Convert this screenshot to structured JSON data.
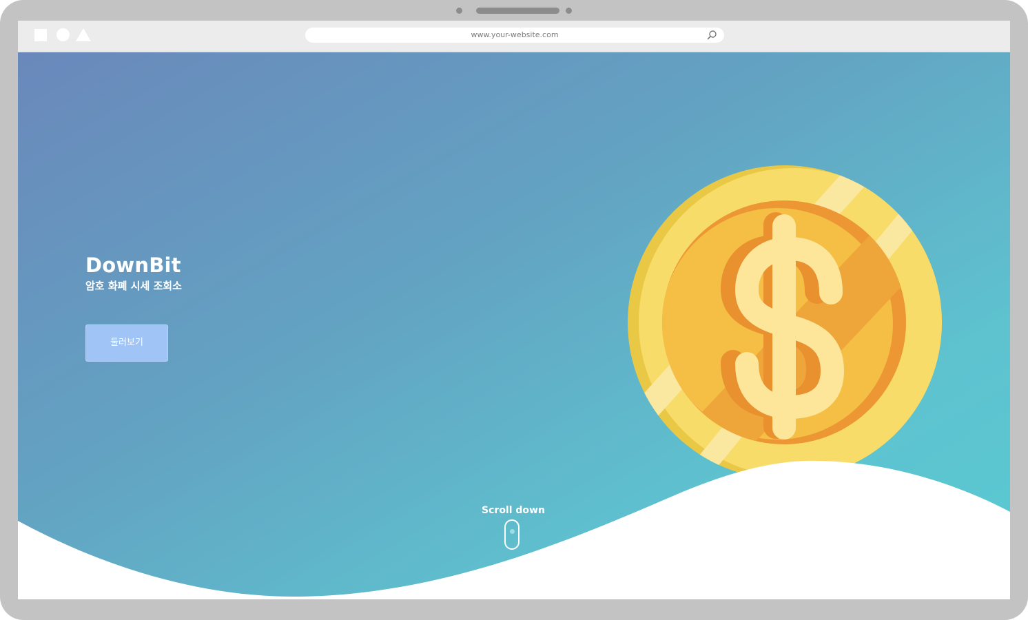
{
  "browser": {
    "url": "www.your-website.com",
    "window_controls": [
      "square-shape",
      "circle-shape",
      "triangle-shape"
    ]
  },
  "hero": {
    "title": "DownBit",
    "subtitle": "암호 화폐 시세 조회소",
    "explore_button_label": "둘러보기",
    "scroll_label": "Scroll down",
    "illustration": "dollar-coin-icon"
  },
  "colors": {
    "device_frame": "#c3c3c3",
    "gradient_start": "#6a88bb",
    "gradient_end": "#58cad2",
    "button_bg": "#a1c4f6",
    "coin_outer": "#f8dc6a",
    "coin_inner": "#f3b240",
    "dollar_sign": "#fde69a"
  }
}
